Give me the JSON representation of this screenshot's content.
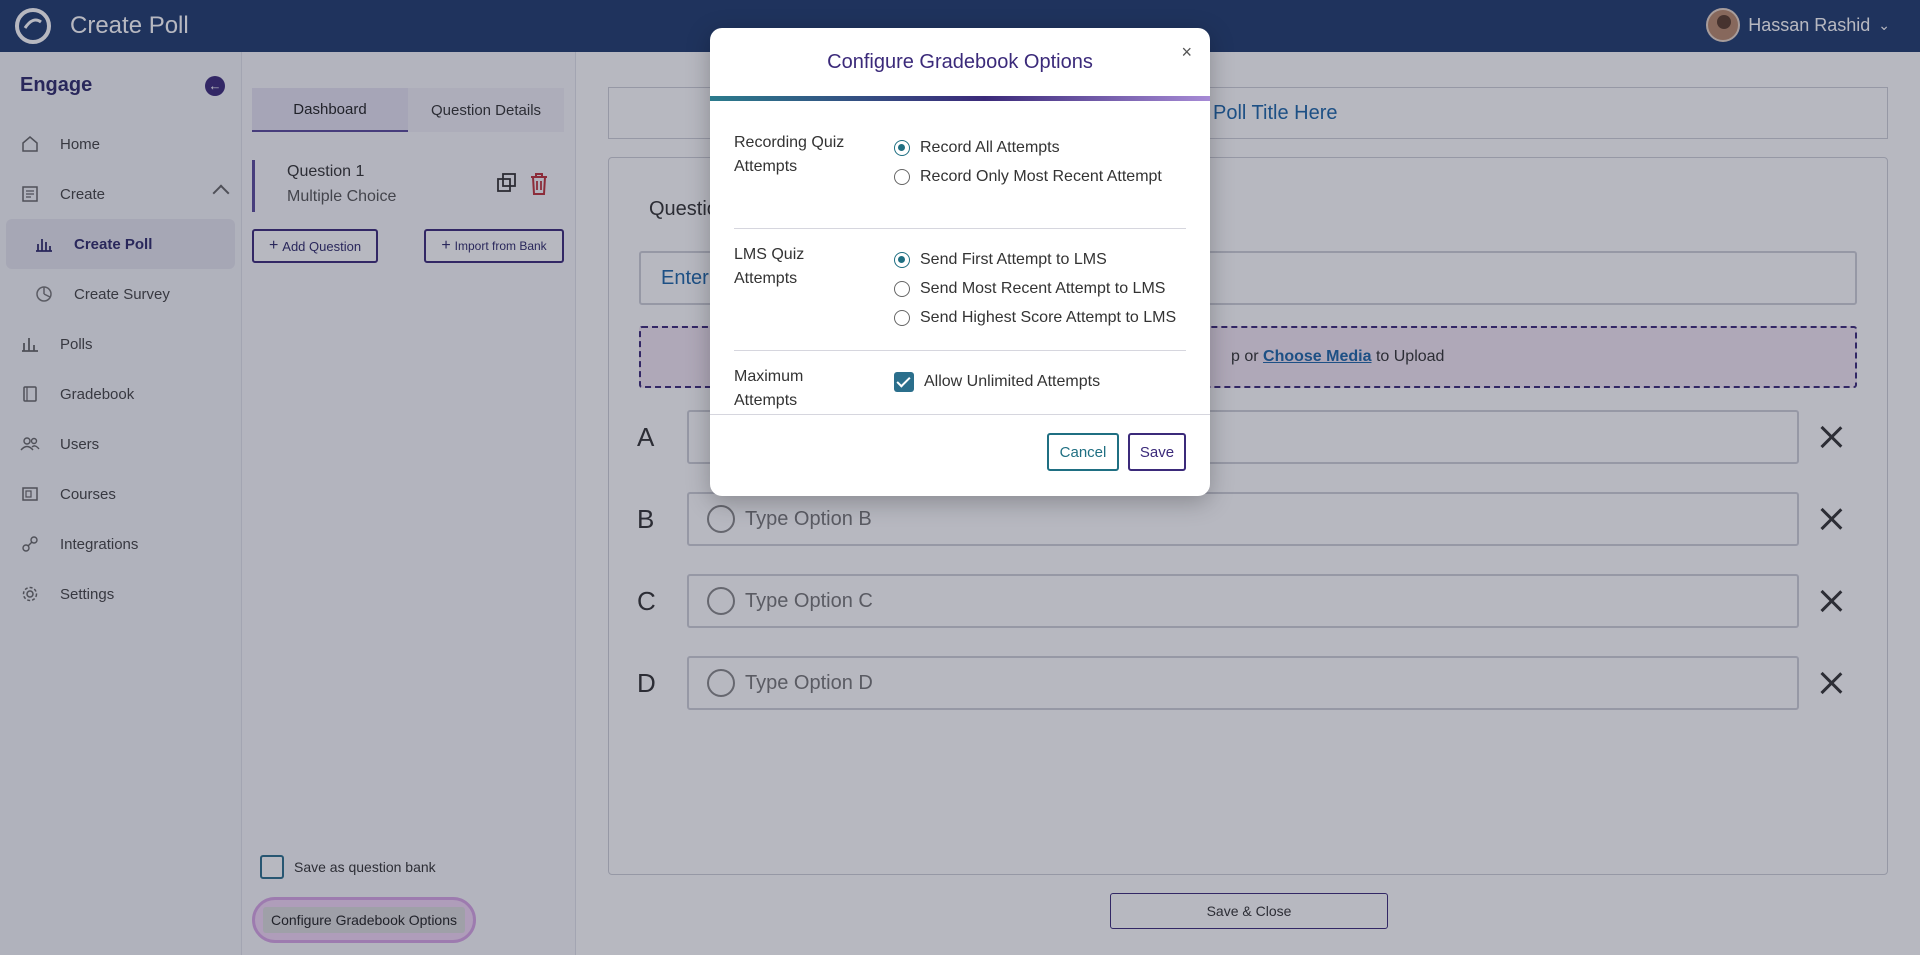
{
  "topbar": {
    "title": "Create Poll",
    "user_name": "Hassan Rashid"
  },
  "sidebar": {
    "brand": "Engage",
    "items": [
      {
        "label": "Home",
        "icon": "home-icon"
      },
      {
        "label": "Create",
        "icon": "create-icon"
      },
      {
        "label": "Create Poll",
        "icon": "poll-chart-icon"
      },
      {
        "label": "Create Survey",
        "icon": "survey-icon"
      },
      {
        "label": "Polls",
        "icon": "bar-chart-icon"
      },
      {
        "label": "Gradebook",
        "icon": "book-icon"
      },
      {
        "label": "Users",
        "icon": "users-icon"
      },
      {
        "label": "Courses",
        "icon": "courses-icon"
      },
      {
        "label": "Integrations",
        "icon": "integrations-icon"
      },
      {
        "label": "Settings",
        "icon": "gear-icon"
      }
    ]
  },
  "panel": {
    "tabs": [
      "Dashboard",
      "Question Details"
    ],
    "question": {
      "title": "Question 1",
      "type": "Multiple Choice"
    },
    "add_question": "Add Question",
    "import_bank": "Import from Bank",
    "save_bank_label": "Save as question bank",
    "configure_label": "Configure Gradebook Options"
  },
  "editor": {
    "poll_title_placeholder": "Poll Title Here",
    "question_label": "Questio",
    "question_input": "Enter",
    "dropzone_prefix": "p or",
    "dropzone_link": "Choose Media",
    "dropzone_suffix": "to Upload",
    "options": [
      {
        "letter": "A",
        "placeholder": ""
      },
      {
        "letter": "B",
        "placeholder": "Type Option B"
      },
      {
        "letter": "C",
        "placeholder": "Type Option C"
      },
      {
        "letter": "D",
        "placeholder": "Type Option D"
      }
    ],
    "save_close": "Save & Close"
  },
  "modal": {
    "title": "Configure Gradebook Options",
    "sections": [
      {
        "label": "Recording Quiz Attempts",
        "options": [
          {
            "label": "Record All Attempts",
            "selected": true
          },
          {
            "label": "Record Only Most Recent Attempt",
            "selected": false
          }
        ]
      },
      {
        "label": "LMS Quiz Attempts",
        "options": [
          {
            "label": "Send First Attempt to LMS",
            "selected": true
          },
          {
            "label": "Send Most Recent Attempt to LMS",
            "selected": false
          },
          {
            "label": "Send Highest Score Attempt to LMS",
            "selected": false
          }
        ]
      },
      {
        "label": "Maximum Attempts",
        "checkbox": {
          "label": "Allow Unlimited Attempts",
          "checked": true
        }
      }
    ],
    "cancel": "Cancel",
    "save": "Save"
  }
}
